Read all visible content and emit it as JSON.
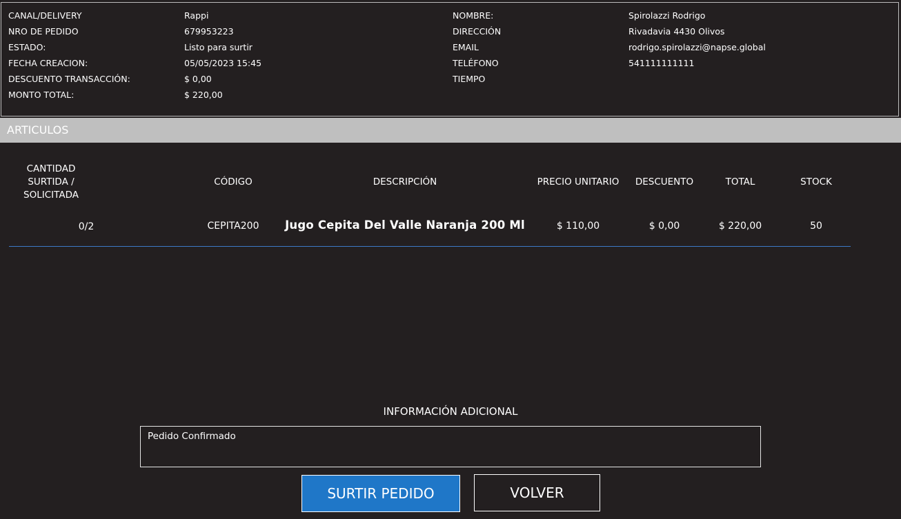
{
  "order": {
    "left": [
      {
        "label": "CANAL/DELIVERY",
        "value": "Rappi"
      },
      {
        "label": "NRO DE PEDIDO",
        "value": "679953223"
      },
      {
        "label": "ESTADO:",
        "value": "Listo para surtir"
      },
      {
        "label": "FECHA CREACION:",
        "value": "05/05/2023 15:45"
      },
      {
        "label": "DESCUENTO TRANSACCIÓN:",
        "value": "$ 0,00"
      },
      {
        "label": "MONTO TOTAL:",
        "value": "$ 220,00"
      }
    ],
    "right": [
      {
        "label": "NOMBRE:",
        "value": "Spirolazzi Rodrigo"
      },
      {
        "label": "DIRECCIÓN",
        "value": "Rivadavia 4430 Olivos"
      },
      {
        "label": "EMAIL",
        "value": "rodrigo.spirolazzi@napse.global"
      },
      {
        "label": "TELÉFONO",
        "value": "541111111111"
      },
      {
        "label": "TIEMPO",
        "value": ""
      }
    ]
  },
  "articles": {
    "section_title": "ARTICULOS",
    "headers": {
      "quantity": "CANTIDAD SURTIDA / SOLICITADA",
      "code": "CÓDIGO",
      "description": "DESCRIPCIÓN",
      "unit_price": "PRECIO UNITARIO",
      "discount": "DESCUENTO",
      "total": "TOTAL",
      "stock": "STOCK"
    },
    "rows": [
      {
        "quantity": "0/2",
        "code": "CEPITA200",
        "description": "Jugo Cepita Del Valle Naranja 200 Ml",
        "unit_price": "$ 110,00",
        "discount": "$ 0,00",
        "total": "$ 220,00",
        "stock": "50"
      }
    ]
  },
  "additional_info": {
    "title": "INFORMACIÓN ADICIONAL",
    "text": "Pedido Confirmado"
  },
  "actions": {
    "fulfill_label": "SURTIR PEDIDO",
    "back_label": "VOLVER"
  },
  "colors": {
    "background": "#231f20",
    "section_bar": "#bfbfbf",
    "primary_button": "#1f77c8",
    "row_divider": "#3d7ac8"
  }
}
